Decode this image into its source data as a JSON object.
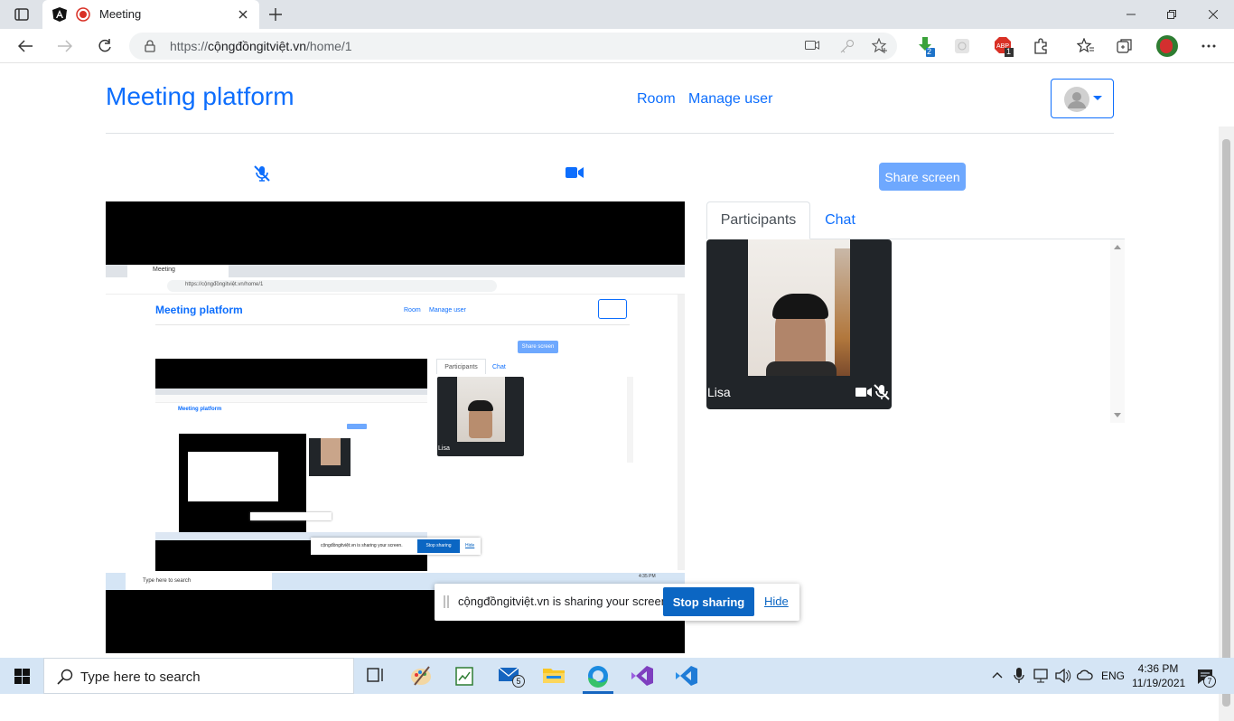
{
  "browser": {
    "tab_title": "Meeting",
    "url_prefix": "https://",
    "url_host": "cộngđồngitviệt.vn",
    "url_path": "/home/1",
    "ext_badge_1": "2",
    "ext_badge_2": "1"
  },
  "header": {
    "brand": "Meeting platform",
    "nav_room": "Room",
    "nav_manage_user": "Manage user"
  },
  "controls": {
    "share_screen_label": "Share screen"
  },
  "side": {
    "tab_participants": "Participants",
    "tab_chat": "Chat",
    "participant_name": "Lisa"
  },
  "share_notice": {
    "message": "cộngđồngitviệt.vn is sharing your screen.",
    "stop_label": "Stop sharing",
    "hide_label": "Hide"
  },
  "taskbar": {
    "search_placeholder": "Type here to search",
    "mail_badge": "5",
    "language": "ENG",
    "time": "4:36 PM",
    "date": "11/19/2021",
    "notification_count": "7"
  },
  "mirror": {
    "brand": "Meeting platform",
    "nav_room": "Room",
    "nav_manage_user": "Manage user",
    "share_screen_label": "Share screen",
    "tab_participants": "Participants",
    "tab_chat": "Chat",
    "participant_name": "Lisa",
    "tab_title": "Meeting",
    "url": "https://cộngđồngitviệt.vn/home/1",
    "notice_message": "cộngđồngitviệt.vn is sharing your screen.",
    "notice_stop": "Stop sharing",
    "notice_hide": "Hide",
    "search_placeholder": "Type here to search",
    "time": "4:35 PM"
  },
  "colors": {
    "primary": "#0d6efd",
    "share_button": "#6ea8fe",
    "stop_button": "#0b66c3",
    "tile_bg": "#212529"
  }
}
